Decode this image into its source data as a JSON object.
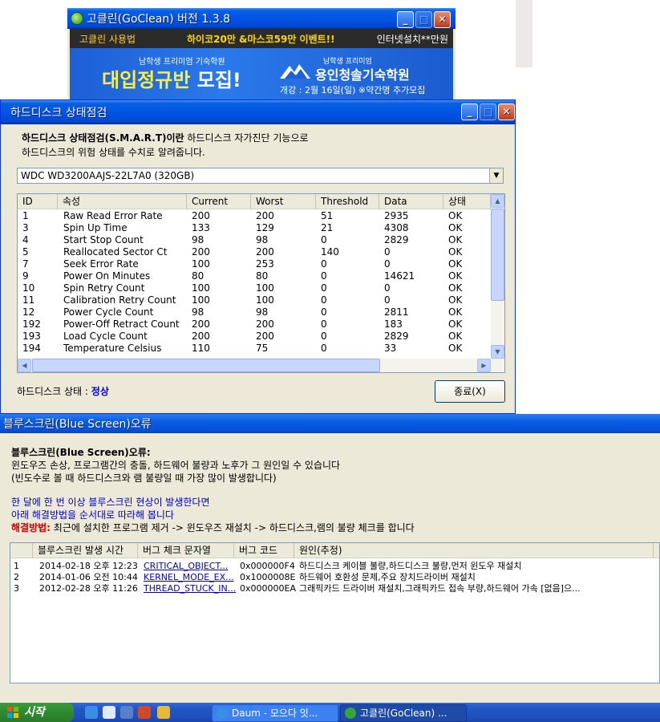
{
  "goclean": {
    "title": "고클린(GoClean) 버전 1.3.8",
    "menu": {
      "usage": "고클린 사용법",
      "event": "하이코20만 &마스코59만 이벤트!!",
      "install": "인터넷설치**만원"
    },
    "banner": {
      "small": "남학생 프리미엄 기숙학원",
      "headline_yellow": "대입정규반",
      "headline_white": " 모집!",
      "school_small": "남학생 프리미엄",
      "school": "용인청솔기숙학원",
      "date": "개강 : 2월 16일(일)  ※약간명 추가모집"
    }
  },
  "hdd": {
    "title": "하드디스크 상태점검",
    "desc_bold": "하드디스크 상태점검(S.M.A.R.T)이란",
    "desc_rest": " 하드디스크 자가진단 기능으로",
    "desc_line2": "하드디스크의 위험 상태를 수치로 알려줍니다.",
    "drive": "WDC WD3200AAJS-22L7A0 (320GB)",
    "columns": [
      "ID",
      "속성",
      "Current",
      "Worst",
      "Threshold",
      "Data",
      "상태"
    ],
    "rows": [
      [
        "1",
        "Raw Read Error Rate",
        "200",
        "200",
        "51",
        "2935",
        "OK"
      ],
      [
        "3",
        "Spin Up Time",
        "133",
        "129",
        "21",
        "4308",
        "OK"
      ],
      [
        "4",
        "Start Stop Count",
        "98",
        "98",
        "0",
        "2829",
        "OK"
      ],
      [
        "5",
        "Reallocated Sector Ct",
        "200",
        "200",
        "140",
        "0",
        "OK"
      ],
      [
        "7",
        "Seek Error Rate",
        "100",
        "253",
        "0",
        "0",
        "OK"
      ],
      [
        "9",
        "Power On Minutes",
        "80",
        "80",
        "0",
        "14621",
        "OK"
      ],
      [
        "10",
        "Spin Retry Count",
        "100",
        "100",
        "0",
        "0",
        "OK"
      ],
      [
        "11",
        "Calibration Retry Count",
        "100",
        "100",
        "0",
        "0",
        "OK"
      ],
      [
        "12",
        "Power Cycle Count",
        "98",
        "98",
        "0",
        "2811",
        "OK"
      ],
      [
        "192",
        "Power-Off Retract Count",
        "200",
        "200",
        "0",
        "183",
        "OK"
      ],
      [
        "193",
        "Load Cycle Count",
        "200",
        "200",
        "0",
        "2829",
        "OK"
      ],
      [
        "194",
        "Temperature Celsius",
        "110",
        "75",
        "0",
        "33",
        "OK"
      ]
    ],
    "status_label": "하드디스크 상태 : ",
    "status_value": "정상",
    "close_button": "종료(X)"
  },
  "bsod": {
    "title": "블루스크린(Blue Screen)오류",
    "heading": "블루스크린(Blue Screen)오류:",
    "line1": "윈도우즈 손상, 프로그램간의 충돌, 하드웨어 불량과 노후가 그 원인일 수 있습니다",
    "line2": "(빈도수로 볼 때 하드디스크와 램 불량일 때 가장 많이 발생합니다)",
    "line3": "한 달에 한 번 이상 블루스크린 현상이 발생한다면",
    "line4": "아래 해결방법을 순서대로 따라해 봅니다",
    "fix_label": "해결방법:",
    "fix_text": " 최근에 설치한 프로그램 제거 -> 윈도우즈 재설치 -> 하드디스크,램의 불량 체크를 합니다",
    "columns": [
      "",
      "블루스크린 발생 시간",
      "버그 체크 문자열",
      "버그 코드",
      "원인(추정)"
    ],
    "rows": [
      [
        "1",
        "2014-02-18 오후 12:23",
        "CRITICAL_OBJECT...",
        "0x000000F4",
        "하드디스크 케이블 불량,하드디스크 불량,먼저 윈도우 재설치"
      ],
      [
        "2",
        "2014-01-06 오전 10:44",
        "KERNEL_MODE_EX...",
        "0x1000008E",
        "하드웨어 호환성 문제,주요 장치드라이버 재설치"
      ],
      [
        "3",
        "2012-02-28 오후 11:26",
        "THREAD_STUCK_IN...",
        "0x000000EA",
        "그래픽카드 드라이버 재설치,그래픽카드 접속 부량,하드웨어 가속 [없음]으..."
      ]
    ]
  },
  "taskbar": {
    "start": "시작",
    "tasks": [
      "Daum - 모으다 잇...",
      "고클린(GoClean) ..."
    ]
  }
}
